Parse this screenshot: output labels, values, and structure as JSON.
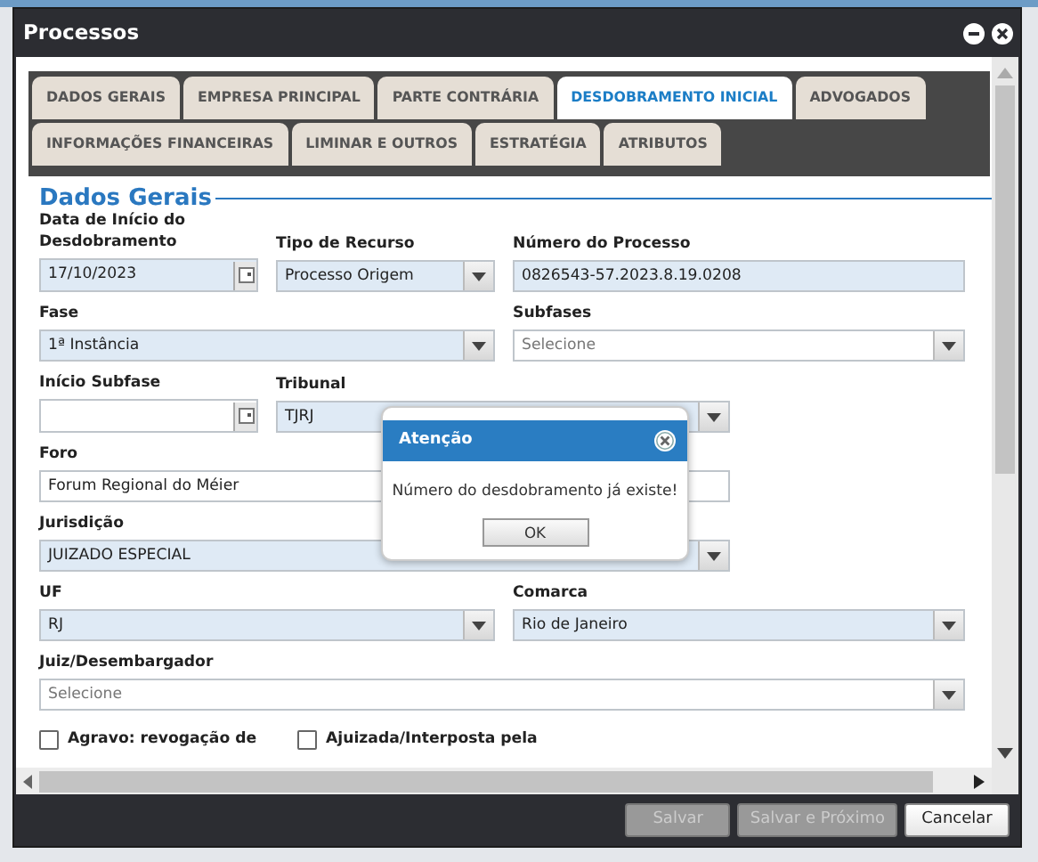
{
  "window": {
    "title": "Processos"
  },
  "tab_rows": [
    [
      {
        "label": "DADOS GERAIS",
        "selected": false
      },
      {
        "label": "EMPRESA PRINCIPAL",
        "selected": false
      },
      {
        "label": "PARTE CONTRÁRIA",
        "selected": false
      },
      {
        "label": "DESDOBRAMENTO INICIAL",
        "selected": true
      },
      {
        "label": "ADVOGADOS",
        "selected": false
      }
    ],
    [
      {
        "label": "INFORMAÇÕES FINANCEIRAS",
        "selected": false
      },
      {
        "label": "LIMINAR E OUTROS",
        "selected": false
      },
      {
        "label": "ESTRATÉGIA",
        "selected": false
      },
      {
        "label": "ATRIBUTOS",
        "selected": false
      }
    ]
  ],
  "section_title": "Dados Gerais",
  "fields": [
    {
      "label": "Data de Início do Desdobramento",
      "kind": "date",
      "value": "17/10/2023",
      "required": true
    },
    {
      "label": "Tipo de Recurso",
      "kind": "select",
      "value": "Processo Origem",
      "required": true
    },
    {
      "label": "Número do Processo",
      "kind": "text",
      "value": "0826543-57.2023.8.19.0208",
      "required": true
    },
    {
      "label": "Fase",
      "kind": "select",
      "value": "1ª Instância",
      "required": true
    },
    {
      "label": "Subfases",
      "kind": "select",
      "placeholder": "Selecione",
      "required": false
    },
    {
      "label": "Início Subfase",
      "kind": "date",
      "required": false
    },
    {
      "label": "Tribunal",
      "kind": "select",
      "value": "TJRJ",
      "required": true
    },
    {
      "label": "Foro",
      "kind": "text",
      "value": "Forum Regional do Méier",
      "required": false
    },
    {
      "label": "Jurisdição",
      "kind": "select",
      "value": "JUIZADO ESPECIAL",
      "required": true
    },
    {
      "label": "UF",
      "kind": "select",
      "value": "RJ",
      "required": true
    },
    {
      "label": "Comarca",
      "kind": "select",
      "value": "Rio de Janeiro",
      "required": true
    },
    {
      "label": "Juiz/Desembargador",
      "kind": "select",
      "placeholder": "Selecione",
      "required": false
    }
  ],
  "checkboxes": [
    {
      "label": "Agravo: revogação de",
      "checked": false
    },
    {
      "label": "Ajuizada/Interposta pela",
      "checked": false
    }
  ],
  "dialog": {
    "title": "Atenção",
    "message": "Número do desdobramento já existe!",
    "button": "OK"
  },
  "footer_buttons": [
    {
      "label": "Salvar",
      "disabled": true
    },
    {
      "label": "Salvar e Próximo",
      "disabled": true
    },
    {
      "label": "Cancelar",
      "disabled": false
    }
  ]
}
